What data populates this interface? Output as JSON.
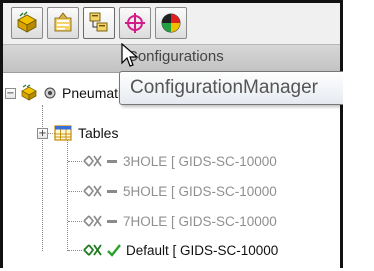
{
  "tabs": [
    {
      "name": "FeatureManager"
    },
    {
      "name": "PropertyManager"
    },
    {
      "name": "ConfigurationManager",
      "active": true
    },
    {
      "name": "DimXpertManager"
    },
    {
      "name": "DisplayManager"
    }
  ],
  "header": {
    "title": "Configurations"
  },
  "tooltip": {
    "text": "ConfigurationManager"
  },
  "tree": {
    "root_label": "Pneumatic Design Gears Cor",
    "tables_label": "Tables",
    "configurations": [
      {
        "label": "3HOLE [ GIDS-SC-10000",
        "active": false
      },
      {
        "label": "5HOLE [ GIDS-SC-10000",
        "active": false
      },
      {
        "label": "7HOLE [ GIDS-SC-10000",
        "active": false
      },
      {
        "label": "Default [ GIDS-SC-10000",
        "active": true
      }
    ]
  },
  "expanders": {
    "root": "−",
    "tables": "+"
  }
}
